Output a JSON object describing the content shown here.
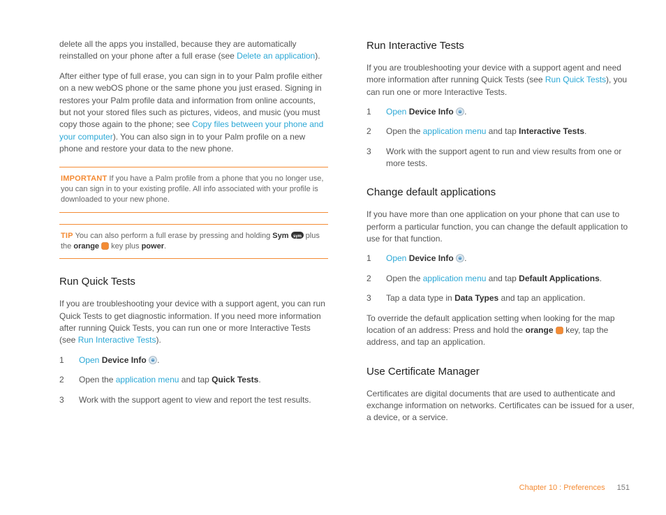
{
  "left": {
    "intro1a": "delete all the apps you installed, because they are automatically reinstalled on your phone after a full erase (see ",
    "intro1link": "Delete an application",
    "intro1b": ").",
    "intro2a": "After either type of full erase, you can sign in to your Palm profile either on a new webOS phone or the same phone you just erased. Signing in restores your Palm profile data and information from online accounts, but not your stored files such as pictures, videos, and music (you must copy those again to the phone; see ",
    "intro2link": "Copy files between your phone and your computer",
    "intro2b": "). You can also sign in to your Palm profile on a new phone and restore your data to the new phone.",
    "important_label": "IMPORTANT",
    "important_text": " If you have a Palm profile from a phone that you no longer use, you can sign in to your existing profile. All info associated with your profile is downloaded to your new phone.",
    "tip_label": "TIP",
    "tip_a": " You can also perform a full erase by pressing and holding ",
    "tip_sym": "Sym",
    "tip_b": " plus the ",
    "tip_orange": "orange",
    "tip_c": " key plus ",
    "tip_power": "power",
    "tip_d": ".",
    "h_quick": "Run Quick Tests",
    "quick_p_a": "If you are troubleshooting your device with a support agent, you can run Quick Tests to get diagnostic information. If you need more information after running Quick Tests, you can run one or more Interactive Tests (see ",
    "quick_p_link": "Run Interactive Tests",
    "quick_p_b": ").",
    "step1_open": "Open",
    "step1_device": " Device Info",
    "step1_end": ".",
    "step2_a": "Open the ",
    "step2_link": "application menu",
    "step2_b": " and tap ",
    "step2_bold": "Quick Tests",
    "step2_c": ".",
    "step3": "Work with the support agent to view and report the test results."
  },
  "right": {
    "h_interactive": "Run Interactive Tests",
    "inter_p_a": "If you are troubleshooting your device with a support agent and need more information after running Quick Tests (see ",
    "inter_p_link": "Run Quick Tests",
    "inter_p_b": "), you can run one or more Interactive Tests.",
    "step1_open": "Open",
    "step1_device": " Device Info",
    "step1_end": ".",
    "step2_a": "Open the ",
    "step2_link": "application menu",
    "step2_b": " and tap ",
    "step2_bold": "Interactive Tests",
    "step2_c": ".",
    "step3": "Work with the support agent to run and view results from one or more tests.",
    "h_default": "Change default applications",
    "def_p": "If you have more than one application on your phone that can use to perform a particular function, you can change the default application to use for that function.",
    "dstep1_open": "Open",
    "dstep1_device": " Device Info",
    "dstep1_end": ".",
    "dstep2_a": "Open the ",
    "dstep2_link": "application menu",
    "dstep2_b": " and tap ",
    "dstep2_bold": "Default Applications",
    "dstep2_c": ".",
    "dstep3_a": "Tap a data type in ",
    "dstep3_bold": "Data Types",
    "dstep3_b": " and tap an application.",
    "override_a": "To override the default application setting when looking for the map location of an address: Press and hold the ",
    "override_orange": "orange",
    "override_b": " key, tap the address, and tap an application.",
    "h_cert": "Use Certificate Manager",
    "cert_p": "Certificates are digital documents that are used to authenticate and exchange information on networks. Certificates can be issued for a user, a device, or a service."
  },
  "footer": {
    "chapter": "Chapter 10 : Preferences",
    "page": "151"
  }
}
